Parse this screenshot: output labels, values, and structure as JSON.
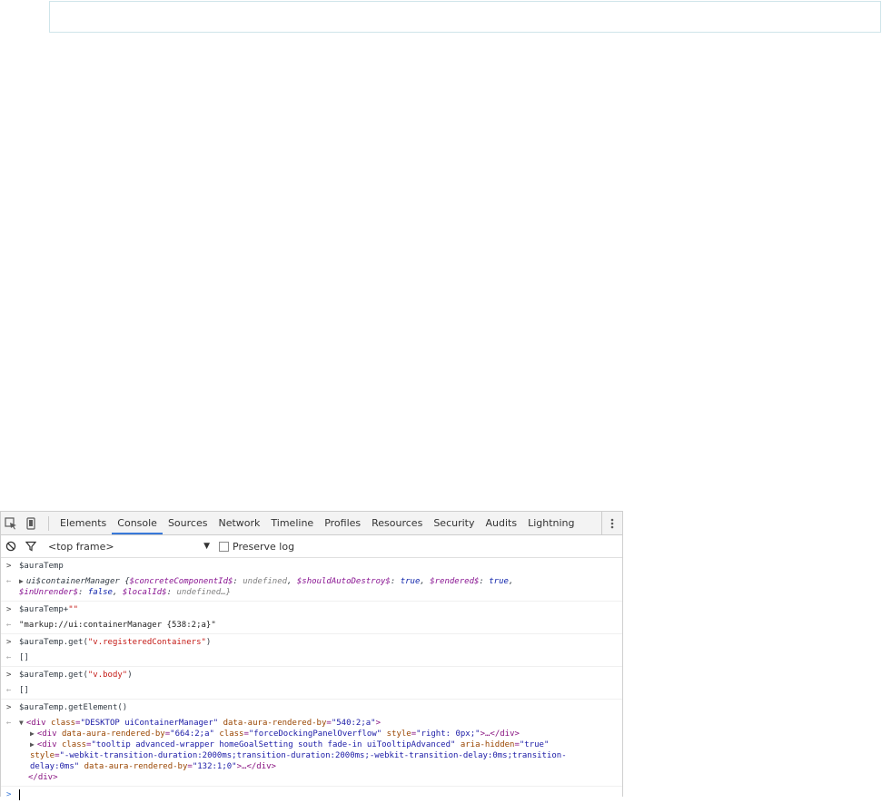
{
  "toolbar": {
    "tabs": [
      "Elements",
      "Console",
      "Sources",
      "Network",
      "Timeline",
      "Profiles",
      "Resources",
      "Security",
      "Audits",
      "Lightning"
    ],
    "active_tab": "Console"
  },
  "filter": {
    "frame": "<top frame>",
    "preserve_log": "Preserve log"
  },
  "console": {
    "cmd1": "$auraTemp",
    "res1_name": "ui$containerManager",
    "res1_props": {
      "p1": "$concreteComponentId$",
      "v1": "undefined",
      "p2": "$shouldAutoDestroy$",
      "v2": "true",
      "p3": "$rendered$",
      "v3": "true",
      "p4": "$inUnrender$",
      "v4": "false",
      "p5": "$localId$",
      "v5": "undefined…}"
    },
    "cmd2_a": "$auraTemp+",
    "cmd2_b": "\"\"",
    "res2": "\"markup://ui:containerManager {538:2;a}\"",
    "cmd3_a": "$auraTemp.get(",
    "cmd3_b": "\"v.registeredContainers\"",
    "cmd3_c": ")",
    "res3": "[]",
    "cmd4_a": "$auraTemp.get(",
    "cmd4_b": "\"v.body\"",
    "cmd4_c": ")",
    "res4": "[]",
    "cmd5": "$auraTemp.getElement()",
    "dom": {
      "l1_tag": "<div",
      "l1_a1": "class",
      "l1_v1": "\"DESKTOP uiContainerManager\"",
      "l1_a2": "data-aura-rendered-by",
      "l1_v2": "\"540:2;a\"",
      "l1_end": ">",
      "l2_tag": "<div",
      "l2_a1": "data-aura-rendered-by",
      "l2_v1": "\"664:2;a\"",
      "l2_a2": "class",
      "l2_v2": "\"forceDockingPanelOverflow\"",
      "l2_a3": "style",
      "l2_v3": "\"right: 0px;\"",
      "l2_end": ">…</div>",
      "l3_tag": "<div",
      "l3_a1": "class",
      "l3_v1": "\"tooltip advanced-wrapper homeGoalSetting south fade-in uiTooltipAdvanced\"",
      "l3_a2": "aria-hidden",
      "l3_v2": "\"true\"",
      "l4_a1": "style",
      "l4_v1": "\"-webkit-transition-duration:2000ms;transition-duration:2000ms;-webkit-transition-delay:0ms;transition-",
      "l5_v1": "delay:0ms\"",
      "l5_a2": "data-aura-rendered-by",
      "l5_v2": "\"132:1;0\"",
      "l5_end": ">…</div>",
      "l6": "</div>"
    }
  }
}
